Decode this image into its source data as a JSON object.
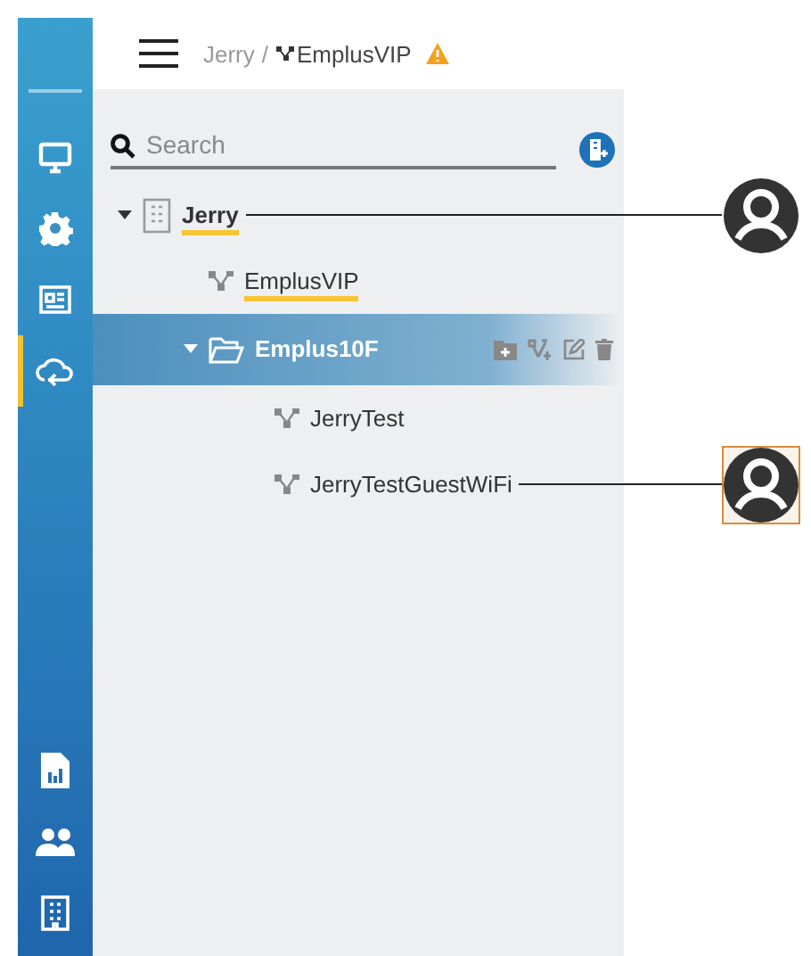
{
  "sidebar": {
    "top_items": [
      {
        "kind": "monitor",
        "selected": false
      },
      {
        "kind": "gear",
        "selected": false
      },
      {
        "kind": "news",
        "selected": false
      },
      {
        "kind": "cloud",
        "selected": true
      }
    ],
    "bottom_items": [
      {
        "kind": "report"
      },
      {
        "kind": "users"
      },
      {
        "kind": "building"
      }
    ]
  },
  "breadcrumb": {
    "parent": "Jerry",
    "separator": "/",
    "current": "EmplusVIP",
    "warning": true
  },
  "search": {
    "placeholder": "Search"
  },
  "tree": [
    {
      "label": "Jerry",
      "kind": "building",
      "expanded": true,
      "selected": false,
      "underlined": true,
      "callout": {
        "highlighted": false
      },
      "children": [
        {
          "label": "EmplusVIP",
          "kind": "network",
          "selected": false,
          "underlined": true
        },
        {
          "label": "Emplus10F",
          "kind": "folder",
          "expanded": true,
          "selected": true,
          "underlined": false,
          "children": [
            {
              "label": "JerryTest",
              "kind": "network",
              "selected": false,
              "underlined": false
            },
            {
              "label": "JerryTestGuestWiFi",
              "kind": "network",
              "selected": false,
              "underlined": false,
              "callout": {
                "highlighted": true
              }
            }
          ]
        }
      ]
    }
  ]
}
